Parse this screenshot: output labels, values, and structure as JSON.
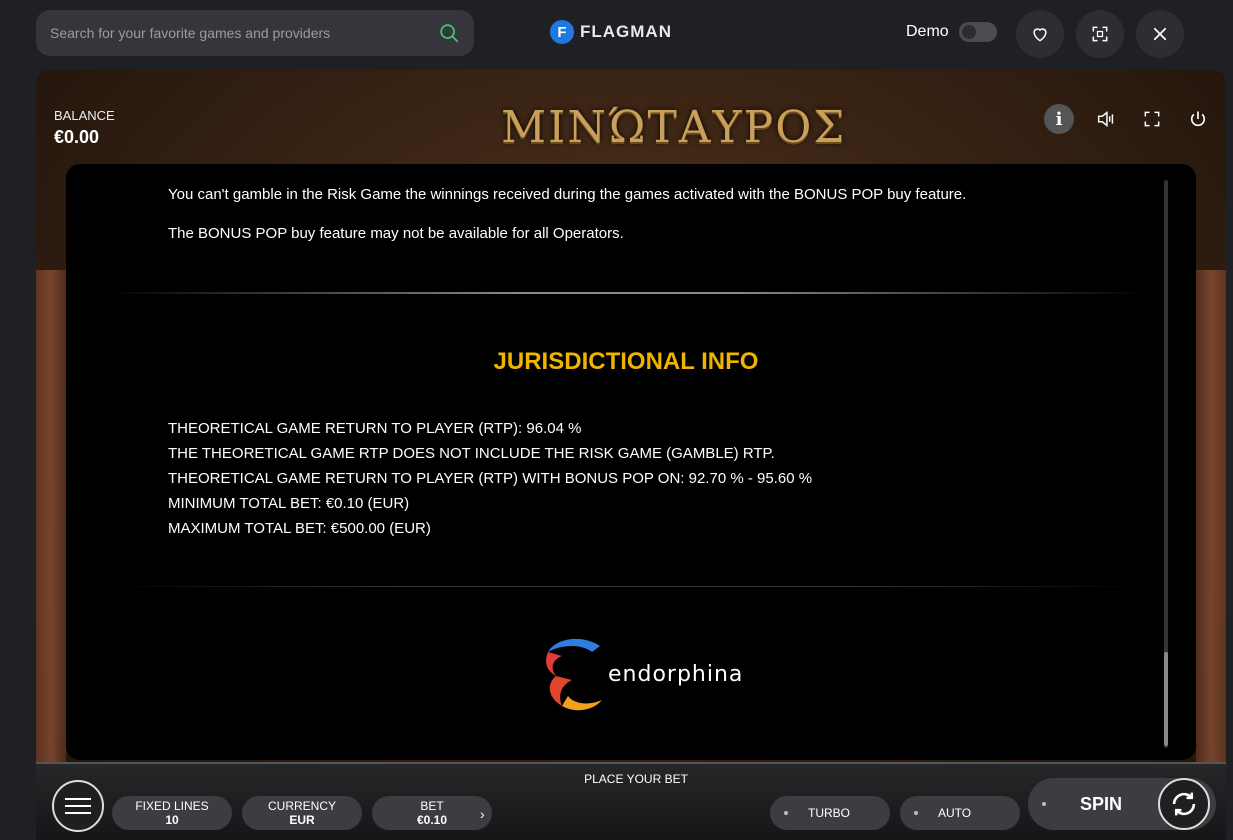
{
  "topbar": {
    "search_placeholder": "Search for your favorite games and providers",
    "brand_letter": "F",
    "brand_name": "FLAGMAN",
    "demo_label": "Demo",
    "demo_enabled": false
  },
  "game": {
    "balance_label": "BALANCE",
    "balance_value": "€0.00",
    "title": "ΜΙΝΏΤΑΥΡΟΣ",
    "info_icon_glyph": "i"
  },
  "panel": {
    "line1": "You can't gamble in the Risk Game the winnings received during the games activated with the BONUS POP buy feature.",
    "line2": "The BONUS POP buy feature may not be available for all Operators.",
    "heading": "JURISDICTIONAL INFO",
    "rtp_lines": [
      "THEORETICAL GAME RETURN TO PLAYER (RTP): 96.04 %",
      "THE THEORETICAL GAME RTP DOES NOT INCLUDE THE RISK GAME (GAMBLE) RTP.",
      "THEORETICAL GAME RETURN TO PLAYER (RTP) WITH BONUS POP ON: 92.70 % - 95.60 %",
      "MINIMUM TOTAL BET: €0.10 (EUR)",
      "MAXIMUM TOTAL BET: €500.00 (EUR)"
    ],
    "provider_name": "endorphina"
  },
  "controls": {
    "place_bet": "PLACE YOUR BET",
    "fixed_lines_label": "FIXED LINES",
    "fixed_lines_value": "10",
    "currency_label": "CURRENCY",
    "currency_value": "EUR",
    "bet_label": "BET",
    "bet_value": "€0.10",
    "turbo_label": "TURBO",
    "auto_label": "AUTO",
    "spin_label": "SPIN"
  },
  "colors": {
    "heading": "#f0b400",
    "brand_blue": "#1e7ae0",
    "search_icon": "#3ec46d"
  }
}
